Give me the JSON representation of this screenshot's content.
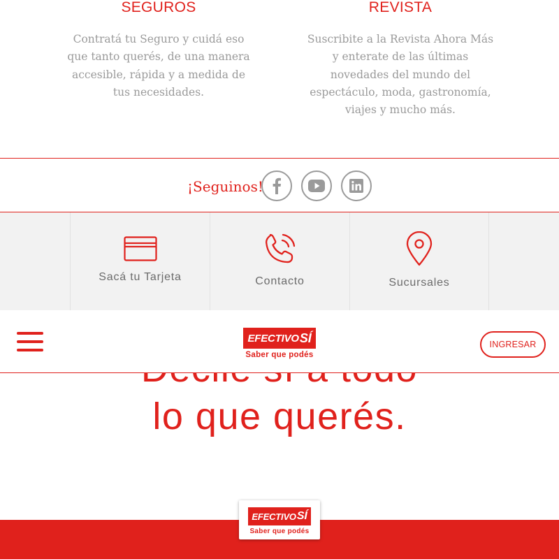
{
  "services": [
    {
      "title": "SEGUROS",
      "text": "Contratá tu Seguro y cuidá eso que tanto querés, de una manera accesible, rápida y a medida de tus necesidades."
    },
    {
      "title": "REVISTA",
      "text": "Suscribite a la Revista Ahora Más y enterate de las últimas novedades del mundo del espectáculo, moda, gastronomía, viajes y mucho más."
    }
  ],
  "social": {
    "label": "¡Seguinos!",
    "items": [
      {
        "name": "facebook",
        "icon": "facebook-icon"
      },
      {
        "name": "youtube",
        "icon": "youtube-icon"
      },
      {
        "name": "linkedin",
        "icon": "linkedin-icon"
      }
    ]
  },
  "quick_links": [
    {
      "label": "Sacá tu Tarjeta",
      "icon": "credit-card-icon"
    },
    {
      "label": "Contacto",
      "icon": "phone-icon"
    },
    {
      "label": "Sucursales",
      "icon": "map-pin-icon"
    }
  ],
  "header": {
    "logo_text": "EFECTIVO",
    "logo_si": "SÍ",
    "logo_tagline": "Saber que podés",
    "login_label": "INGRESAR",
    "menu_icon": "hamburger-menu-icon"
  },
  "hero": {
    "line1": "Decile sí a todo",
    "line2": "lo que querés."
  },
  "footer": {
    "logo_text": "EFECTIVO",
    "logo_si": "SÍ",
    "logo_tagline": "Saber que podés"
  },
  "colors": {
    "brand_red": "#e0211c",
    "text_gray": "#9a9a9a",
    "panel_gray": "#f2f2f2"
  }
}
